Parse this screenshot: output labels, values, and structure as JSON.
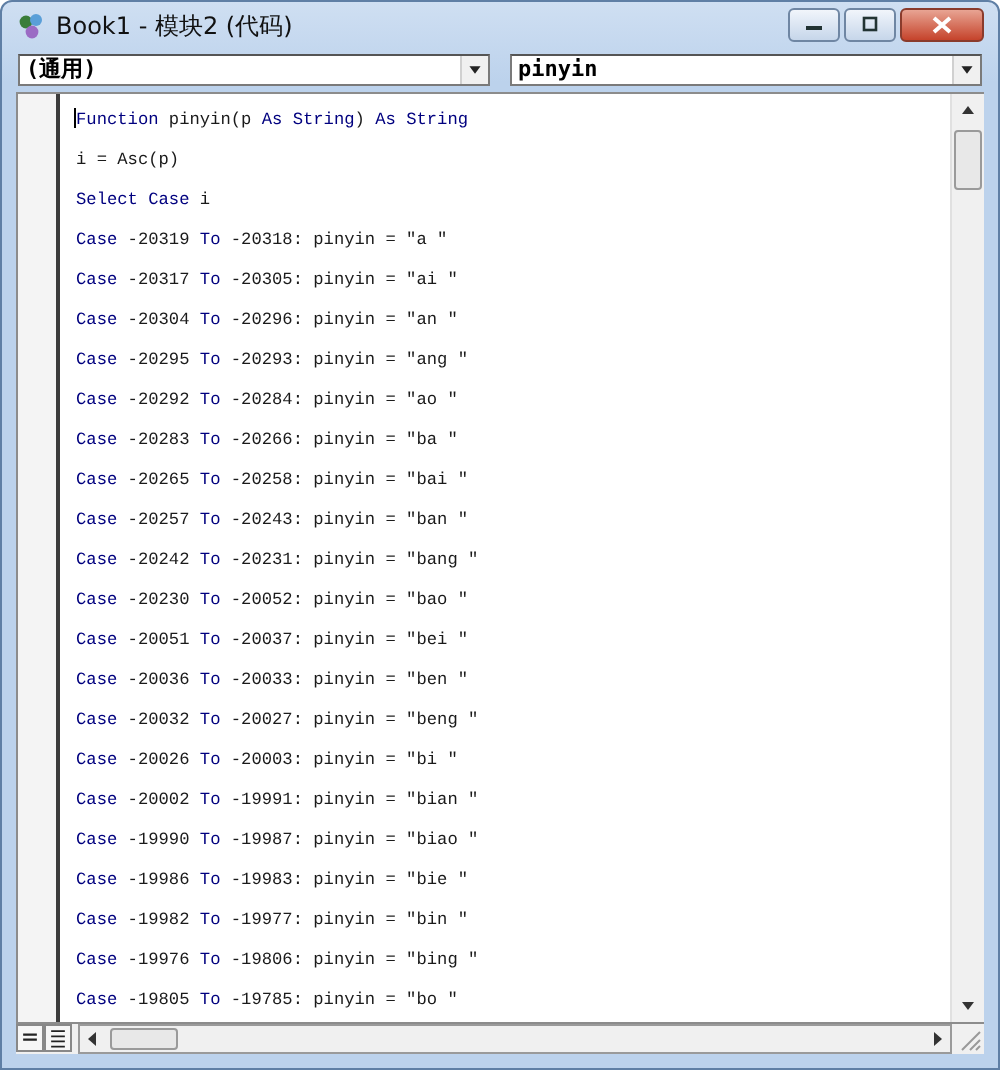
{
  "window": {
    "title": "Book1 - 模块2 (代码)"
  },
  "object_box": {
    "value": "(通用)"
  },
  "procedure_box": {
    "value": "pinyin"
  },
  "code_lines": [
    {
      "segments": [
        {
          "text": "Function",
          "kind": "keyword"
        },
        {
          "text": " pinyin(p ",
          "kind": "plain"
        },
        {
          "text": "As String",
          "kind": "keyword"
        },
        {
          "text": ") ",
          "kind": "plain"
        },
        {
          "text": "As String",
          "kind": "keyword"
        }
      ]
    },
    {
      "segments": [
        {
          "text": "i = Asc(p)",
          "kind": "plain"
        }
      ]
    },
    {
      "segments": [
        {
          "text": "Select Case",
          "kind": "keyword"
        },
        {
          "text": " i",
          "kind": "plain"
        }
      ]
    },
    {
      "segments": [
        {
          "text": "Case",
          "kind": "keyword"
        },
        {
          "text": " -20319 ",
          "kind": "plain"
        },
        {
          "text": "To",
          "kind": "keyword"
        },
        {
          "text": " -20318: pinyin = \"a \"",
          "kind": "plain"
        }
      ]
    },
    {
      "segments": [
        {
          "text": "Case",
          "kind": "keyword"
        },
        {
          "text": " -20317 ",
          "kind": "plain"
        },
        {
          "text": "To",
          "kind": "keyword"
        },
        {
          "text": " -20305: pinyin = \"ai \"",
          "kind": "plain"
        }
      ]
    },
    {
      "segments": [
        {
          "text": "Case",
          "kind": "keyword"
        },
        {
          "text": " -20304 ",
          "kind": "plain"
        },
        {
          "text": "To",
          "kind": "keyword"
        },
        {
          "text": " -20296: pinyin = \"an \"",
          "kind": "plain"
        }
      ]
    },
    {
      "segments": [
        {
          "text": "Case",
          "kind": "keyword"
        },
        {
          "text": " -20295 ",
          "kind": "plain"
        },
        {
          "text": "To",
          "kind": "keyword"
        },
        {
          "text": " -20293: pinyin = \"ang \"",
          "kind": "plain"
        }
      ]
    },
    {
      "segments": [
        {
          "text": "Case",
          "kind": "keyword"
        },
        {
          "text": " -20292 ",
          "kind": "plain"
        },
        {
          "text": "To",
          "kind": "keyword"
        },
        {
          "text": " -20284: pinyin = \"ao \"",
          "kind": "plain"
        }
      ]
    },
    {
      "segments": [
        {
          "text": "Case",
          "kind": "keyword"
        },
        {
          "text": " -20283 ",
          "kind": "plain"
        },
        {
          "text": "To",
          "kind": "keyword"
        },
        {
          "text": " -20266: pinyin = \"ba \"",
          "kind": "plain"
        }
      ]
    },
    {
      "segments": [
        {
          "text": "Case",
          "kind": "keyword"
        },
        {
          "text": " -20265 ",
          "kind": "plain"
        },
        {
          "text": "To",
          "kind": "keyword"
        },
        {
          "text": " -20258: pinyin = \"bai \"",
          "kind": "plain"
        }
      ]
    },
    {
      "segments": [
        {
          "text": "Case",
          "kind": "keyword"
        },
        {
          "text": " -20257 ",
          "kind": "plain"
        },
        {
          "text": "To",
          "kind": "keyword"
        },
        {
          "text": " -20243: pinyin = \"ban \"",
          "kind": "plain"
        }
      ]
    },
    {
      "segments": [
        {
          "text": "Case",
          "kind": "keyword"
        },
        {
          "text": " -20242 ",
          "kind": "plain"
        },
        {
          "text": "To",
          "kind": "keyword"
        },
        {
          "text": " -20231: pinyin = \"bang \"",
          "kind": "plain"
        }
      ]
    },
    {
      "segments": [
        {
          "text": "Case",
          "kind": "keyword"
        },
        {
          "text": " -20230 ",
          "kind": "plain"
        },
        {
          "text": "To",
          "kind": "keyword"
        },
        {
          "text": " -20052: pinyin = \"bao \"",
          "kind": "plain"
        }
      ]
    },
    {
      "segments": [
        {
          "text": "Case",
          "kind": "keyword"
        },
        {
          "text": " -20051 ",
          "kind": "plain"
        },
        {
          "text": "To",
          "kind": "keyword"
        },
        {
          "text": " -20037: pinyin = \"bei \"",
          "kind": "plain"
        }
      ]
    },
    {
      "segments": [
        {
          "text": "Case",
          "kind": "keyword"
        },
        {
          "text": " -20036 ",
          "kind": "plain"
        },
        {
          "text": "To",
          "kind": "keyword"
        },
        {
          "text": " -20033: pinyin = \"ben \"",
          "kind": "plain"
        }
      ]
    },
    {
      "segments": [
        {
          "text": "Case",
          "kind": "keyword"
        },
        {
          "text": " -20032 ",
          "kind": "plain"
        },
        {
          "text": "To",
          "kind": "keyword"
        },
        {
          "text": " -20027: pinyin = \"beng \"",
          "kind": "plain"
        }
      ]
    },
    {
      "segments": [
        {
          "text": "Case",
          "kind": "keyword"
        },
        {
          "text": " -20026 ",
          "kind": "plain"
        },
        {
          "text": "To",
          "kind": "keyword"
        },
        {
          "text": " -20003: pinyin = \"bi \"",
          "kind": "plain"
        }
      ]
    },
    {
      "segments": [
        {
          "text": "Case",
          "kind": "keyword"
        },
        {
          "text": " -20002 ",
          "kind": "plain"
        },
        {
          "text": "To",
          "kind": "keyword"
        },
        {
          "text": " -19991: pinyin = \"bian \"",
          "kind": "plain"
        }
      ]
    },
    {
      "segments": [
        {
          "text": "Case",
          "kind": "keyword"
        },
        {
          "text": " -19990 ",
          "kind": "plain"
        },
        {
          "text": "To",
          "kind": "keyword"
        },
        {
          "text": " -19987: pinyin = \"biao \"",
          "kind": "plain"
        }
      ]
    },
    {
      "segments": [
        {
          "text": "Case",
          "kind": "keyword"
        },
        {
          "text": " -19986 ",
          "kind": "plain"
        },
        {
          "text": "To",
          "kind": "keyword"
        },
        {
          "text": " -19983: pinyin = \"bie \"",
          "kind": "plain"
        }
      ]
    },
    {
      "segments": [
        {
          "text": "Case",
          "kind": "keyword"
        },
        {
          "text": " -19982 ",
          "kind": "plain"
        },
        {
          "text": "To",
          "kind": "keyword"
        },
        {
          "text": " -19977: pinyin = \"bin \"",
          "kind": "plain"
        }
      ]
    },
    {
      "segments": [
        {
          "text": "Case",
          "kind": "keyword"
        },
        {
          "text": " -19976 ",
          "kind": "plain"
        },
        {
          "text": "To",
          "kind": "keyword"
        },
        {
          "text": " -19806: pinyin = \"bing \"",
          "kind": "plain"
        }
      ]
    },
    {
      "segments": [
        {
          "text": "Case",
          "kind": "keyword"
        },
        {
          "text": " -19805 ",
          "kind": "plain"
        },
        {
          "text": "To",
          "kind": "keyword"
        },
        {
          "text": " -19785: pinyin = \"bo \"",
          "kind": "plain"
        }
      ]
    }
  ]
}
